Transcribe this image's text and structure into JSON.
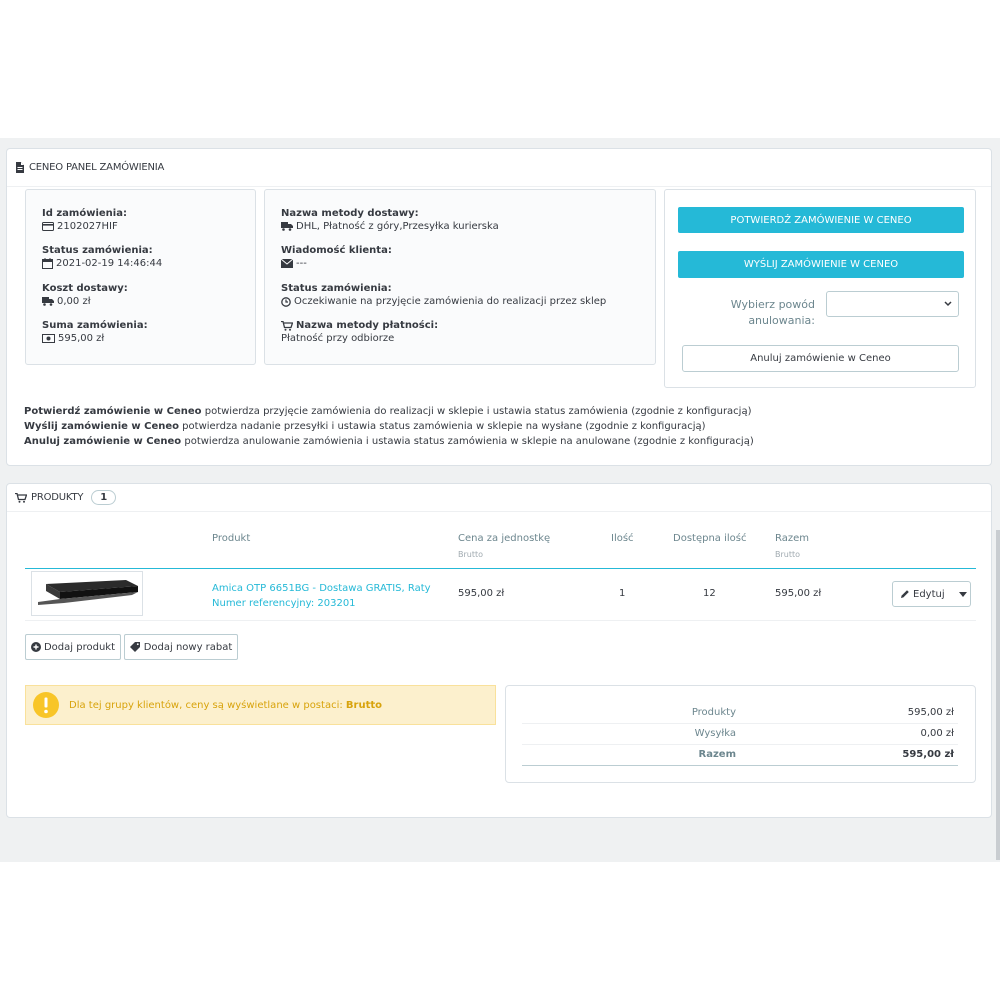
{
  "ceneo_panel": {
    "title": "CENEO PANEL ZAMÓWIENIA",
    "order_id_label": "Id zamówienia:",
    "order_id": "2102027HIF",
    "status_label": "Status zamówienia:",
    "status_date": "2021-02-19 14:46:44",
    "shipping_cost_label": "Koszt dostawy:",
    "shipping_cost": "0,00 zł",
    "order_sum_label": "Suma zamówienia:",
    "order_sum": "595,00 zł",
    "delivery_method_label": "Nazwa metody dostawy:",
    "delivery_method": "DHL, Płatność z góry,Przesyłka kurierska",
    "client_message_label": "Wiadomość klienta:",
    "client_message": "---",
    "order_status_label": "Status zamówienia:",
    "order_status": "Oczekiwanie na przyjęcie zamówienia do realizacji przez sklep",
    "payment_method_label": "Nazwa metody płatności:",
    "payment_method": "Płatność przy odbiorze",
    "confirm_button": "POTWIERDŹ ZAMÓWIENIE W CENEO",
    "send_button": "WYŚLIJ ZAMÓWIENIE W CENEO",
    "cancel_reason_label_1": "Wybierz powód",
    "cancel_reason_label_2": "anulowania:",
    "cancel_reason_value": "",
    "cancel_button": "Anuluj zamówienie w Ceneo",
    "desc1_bold": "Potwierdź zamówienie w Ceneo",
    "desc1_text": " potwierdza przyjęcie zamówienia do realizacji w sklepie i ustawia status zamówienia (zgodnie z konfiguracją)",
    "desc2_bold": "Wyślij zamówienie w Ceneo",
    "desc2_text": " potwierdza nadanie przesyłki i ustawia status zamówienia w sklepie na wysłane (zgodnie z konfiguracją)",
    "desc3_bold": "Anuluj zamówienie w Ceneo",
    "desc3_text": " potwierdza anulowanie zamówienia i ustawia status zamówienia w sklepie na anulowane (zgodnie z konfiguracją)"
  },
  "products_panel": {
    "title": "PRODUKTY",
    "count": "1",
    "columns": {
      "product": "Produkt",
      "unit_price": "Cena za jednostkę",
      "unit_price_sub": "Brutto",
      "quantity": "Ilość",
      "available": "Dostępna ilość",
      "total": "Razem",
      "total_sub": "Brutto"
    },
    "rows": [
      {
        "name": "Amica OTP 6651BG - Dostawa GRATIS, Raty",
        "reference": "Numer referencyjny: 203201",
        "unit_price": "595,00 zł",
        "quantity": "1",
        "available": "12",
        "total": "595,00 zł",
        "edit_label": "Edytuj"
      }
    ],
    "add_product_button": "Dodaj produkt",
    "add_discount_button": "Dodaj nowy rabat",
    "alert_text": "Dla tej grupy klientów, ceny są wyświetlane w postaci: ",
    "alert_bold": "Brutto",
    "totals": {
      "products_label": "Produkty",
      "products_value": "595,00 zł",
      "shipping_label": "Wysyłka",
      "shipping_value": "0,00 zł",
      "total_label": "Razem",
      "total_value": "595,00 zł"
    }
  },
  "colors": {
    "primary": "#25b9d7",
    "warning_bg": "#fcf0cd",
    "warning_text": "#d8a30c",
    "page_bg": "#eff1f2"
  }
}
